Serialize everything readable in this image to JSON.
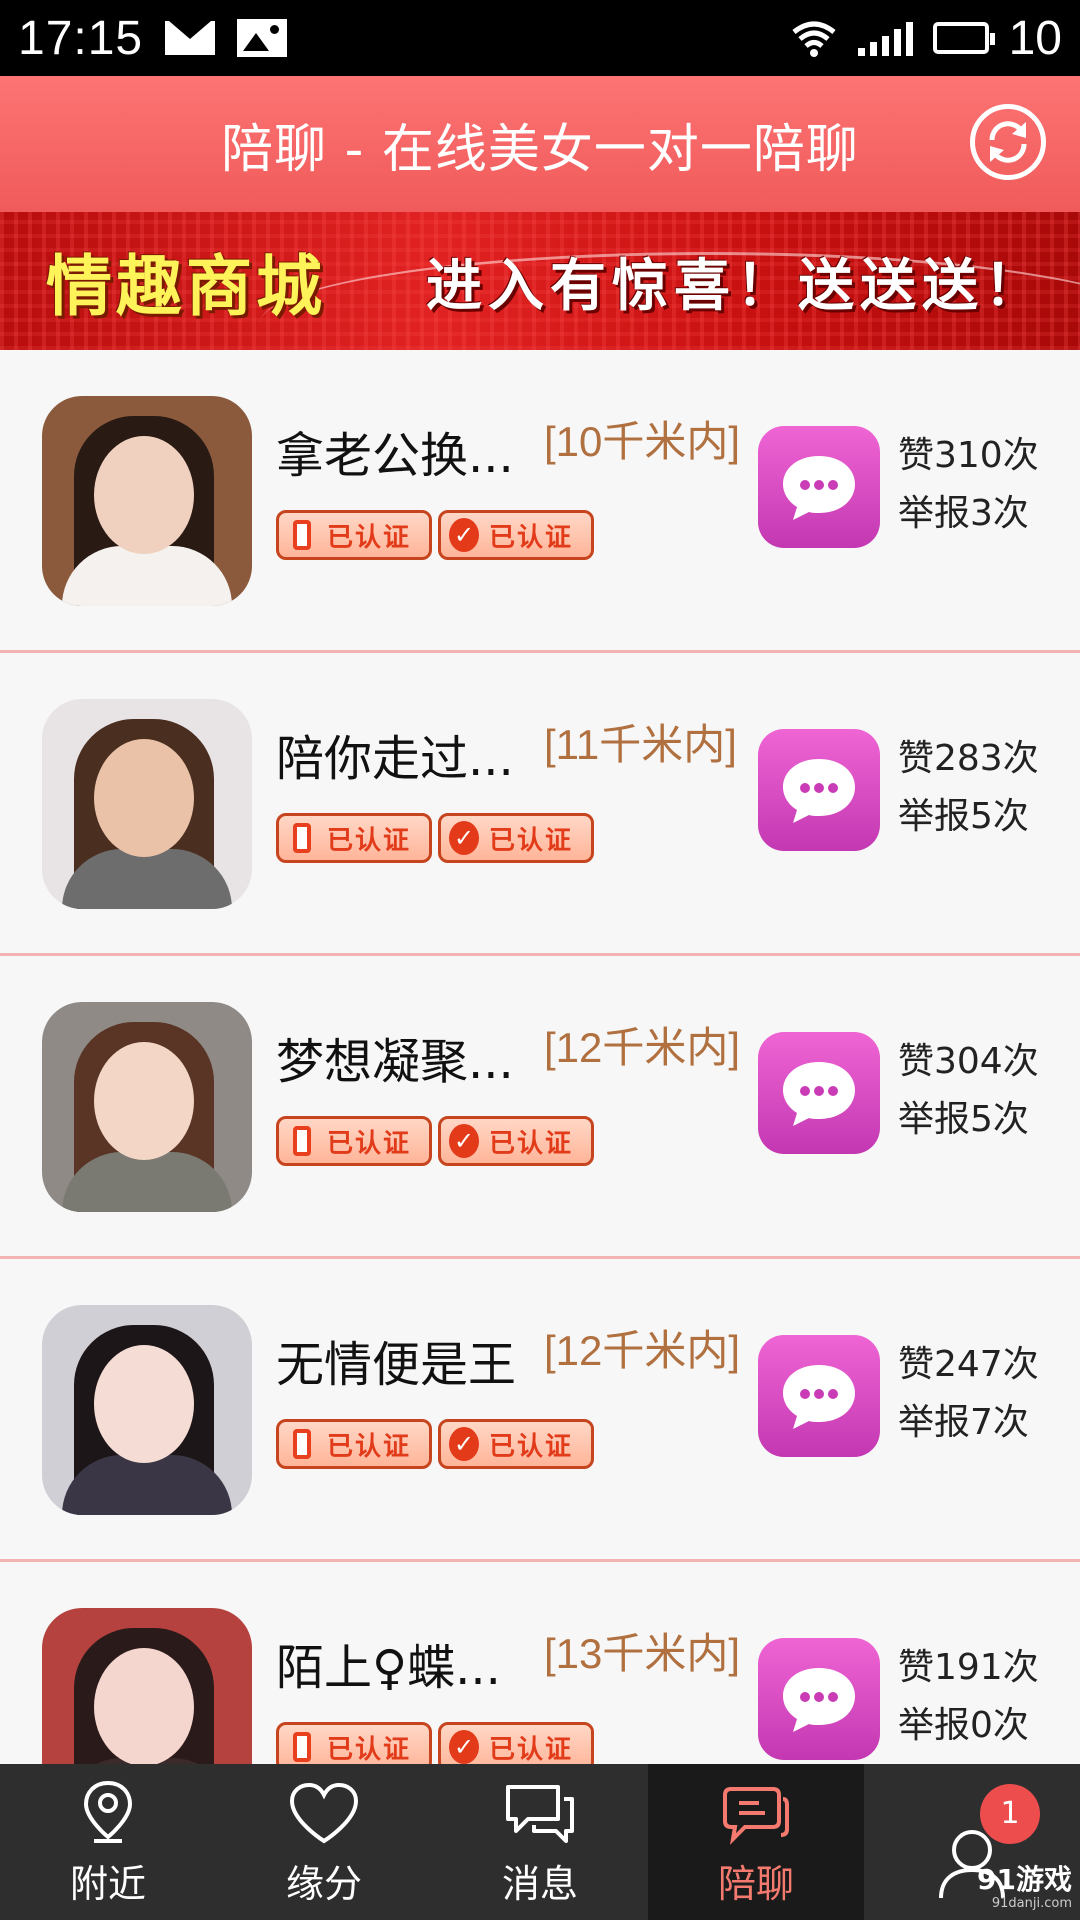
{
  "status_bar": {
    "time": "17:15",
    "battery": "10"
  },
  "header": {
    "title": "陪聊 - 在线美女一对一陪聊"
  },
  "banner": {
    "left_text": "情趣商城",
    "right_text": "进入有惊喜！送送送！"
  },
  "list": [
    {
      "name": "拿老公换...",
      "distance": "[10千米内]",
      "badge1": "已认证",
      "badge2": "已认证",
      "likes": "赞310次",
      "reports": "举报3次",
      "hair": "#2a1a14",
      "skin": "#f0d0bf",
      "bg": "#8b5a3c",
      "top": "#f4f1ee"
    },
    {
      "name": "陪你走过...",
      "distance": "[11千米内]",
      "badge1": "已认证",
      "badge2": "已认证",
      "likes": "赞283次",
      "reports": "举报5次",
      "hair": "#4a2e20",
      "skin": "#e9c2a8",
      "bg": "#e8e4e6",
      "top": "#6d6d6d"
    },
    {
      "name": "梦想凝聚...",
      "distance": "[12千米内]",
      "badge1": "已认证",
      "badge2": "已认证",
      "likes": "赞304次",
      "reports": "举报5次",
      "hair": "#5a3424",
      "skin": "#f3d6c6",
      "bg": "#8f8a86",
      "top": "#7a7a72"
    },
    {
      "name": "无情便是王",
      "distance": "[12千米内]",
      "badge1": "已认证",
      "badge2": "已认证",
      "likes": "赞247次",
      "reports": "举报7次",
      "hair": "#1d1618",
      "skin": "#f5dcd4",
      "bg": "#cfcfd5",
      "top": "#3b3645"
    },
    {
      "name": "陌上♀蝶...",
      "distance": "[13千米内]",
      "badge1": "已认证",
      "badge2": "已认证",
      "likes": "赞191次",
      "reports": "举报0次",
      "hair": "#2a1a1a",
      "skin": "#f5d6cf",
      "bg": "#b5423e",
      "top": "#3a2a2a"
    }
  ],
  "bottom_nav": [
    {
      "label": "附近",
      "icon": "location-icon"
    },
    {
      "label": "缘分",
      "icon": "heart-icon"
    },
    {
      "label": "消息",
      "icon": "chat-bubbles-icon"
    },
    {
      "label": "陪聊",
      "icon": "companion-chat-icon",
      "active": true
    },
    {
      "label": "",
      "icon": "user-icon",
      "badge": "1"
    }
  ],
  "watermark": {
    "text": "91游戏",
    "sub": "91danji.com"
  },
  "colors": {
    "header": "#f26262",
    "active_nav": "#f47a70",
    "chat_button": "#d84cc4",
    "distance": "#b07040"
  }
}
